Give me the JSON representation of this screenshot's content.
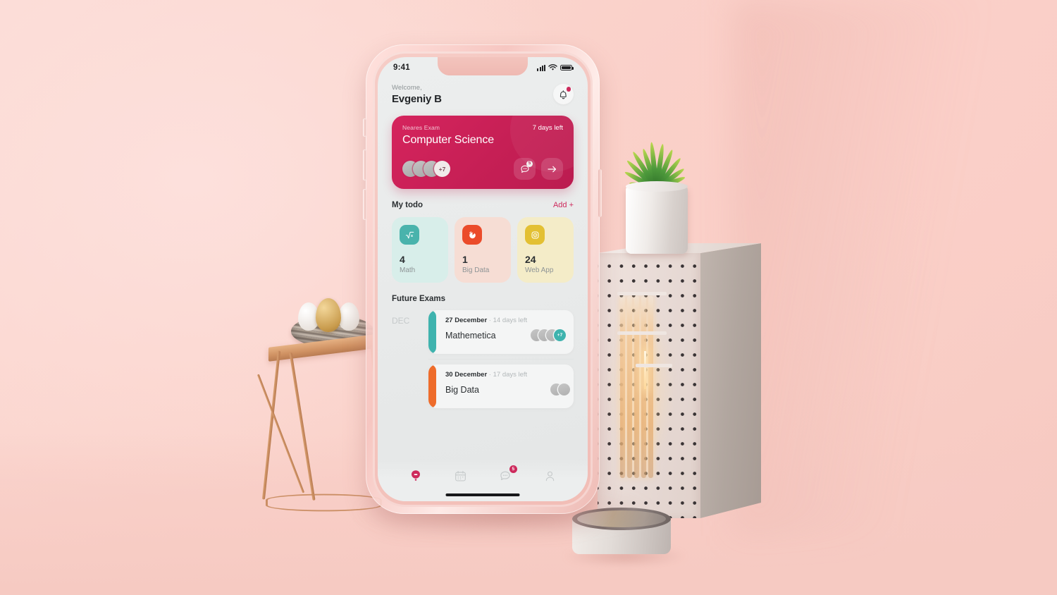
{
  "scene": {
    "background_color": "#fad2ca",
    "objects": [
      {
        "name": "gold-wire-side-table",
        "note": "geometric brass table"
      },
      {
        "name": "bird-nest-with-eggs",
        "note": "three eggs, one gold"
      },
      {
        "name": "potted-plant",
        "note": "green plant in white cylinder pot"
      },
      {
        "name": "pegboard-pedestal",
        "note": "perforated white block"
      },
      {
        "name": "tube-lamp",
        "note": "glowing vertical tubes"
      },
      {
        "name": "metal-canister",
        "note": "short silver cylinder"
      }
    ]
  },
  "phone": {
    "status_bar": {
      "time": "9:41",
      "signal_icon": "signal-bars-icon",
      "wifi_icon": "wifi-icon",
      "battery_icon": "battery-icon"
    },
    "home_indicator": true
  },
  "app": {
    "header": {
      "greeting": "Welcome,",
      "user_name": "Evgeniy B",
      "notification_icon": "bell-icon",
      "has_notification_dot": true
    },
    "hero_card": {
      "label": "Neares Exam",
      "days_left": "7 days left",
      "title": "Computer Science",
      "accent_color": "#c61f55",
      "avatars": [
        "",
        "",
        ""
      ],
      "avatar_more": "+7",
      "chat_button": {
        "icon": "chat-bubble-icon",
        "badge": "5"
      },
      "forward_button": {
        "icon": "arrow-right-icon"
      }
    },
    "todo_section": {
      "title": "My todo",
      "add_label": "Add +",
      "items": [
        {
          "count": "4",
          "name": "Math",
          "icon": "square-root-icon",
          "icon_glyph": "√x",
          "icon_color": "#49b3ac",
          "card_color": "#d8eeea"
        },
        {
          "count": "1",
          "name": "Big Data",
          "icon": "pie-chart-icon",
          "icon_glyph": "◕",
          "icon_color": "#eb4b2a",
          "card_color": "#f6ddd4"
        },
        {
          "count": "24",
          "name": "Web App",
          "icon": "compass-icon",
          "icon_glyph": "◎",
          "icon_color": "#e3c033",
          "card_color": "#f4ecc8"
        }
      ]
    },
    "future_exams": {
      "title": "Future Exams",
      "month_label": "DEC",
      "items": [
        {
          "date": "27 December",
          "separator": "·",
          "days_left": "14 days left",
          "name": "Mathemetica",
          "bar_color": "#3fb3ae",
          "avatars": [
            "",
            "",
            ""
          ],
          "avatar_more": "+7",
          "more_color": "#3fb3ae"
        },
        {
          "date": "30 December",
          "separator": "·",
          "days_left": "17 days left",
          "name": "Big Data",
          "bar_color": "#ee6c2b",
          "avatars": [
            "",
            ""
          ],
          "avatar_more": "",
          "more_color": "#ee6c2b"
        }
      ]
    },
    "tab_bar": {
      "items": [
        {
          "name": "home",
          "icon": "home-icon",
          "active": true,
          "badge": ""
        },
        {
          "name": "calendar",
          "icon": "calendar-icon",
          "active": false,
          "badge": ""
        },
        {
          "name": "messages",
          "icon": "chat-bubble-icon",
          "active": false,
          "badge": "5"
        },
        {
          "name": "profile",
          "icon": "person-icon",
          "active": false,
          "badge": ""
        }
      ],
      "active_color": "#cd2a5c",
      "inactive_color": "#c7cbcc"
    }
  }
}
